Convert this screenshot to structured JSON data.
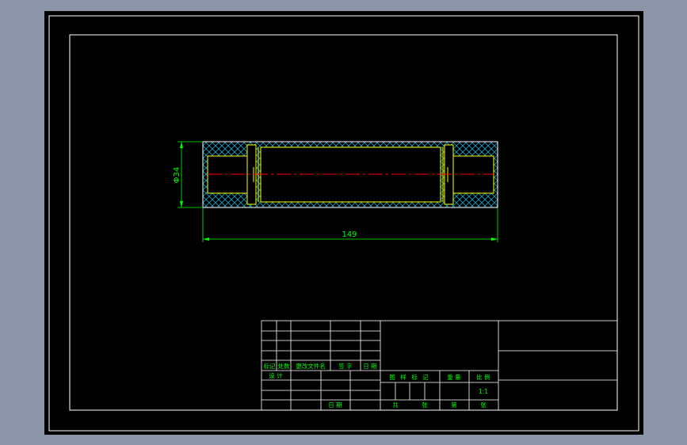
{
  "drawing": {
    "dimensions": {
      "diameter_label": "Φ34",
      "length_label": "149"
    },
    "title_block": {
      "revision_headers": [
        "标记",
        "处数",
        "更改文件名",
        "签 字",
        "日 期"
      ],
      "design_label": "设 计",
      "date_label": "日 期",
      "stage_mark_label": "图 样 标 记",
      "weight_label": "重 量",
      "scale_label": "比 例",
      "scale_value": "1:1",
      "total_label": "共",
      "sheet_unit_1": "张",
      "page_label": "第",
      "sheet_unit_2": "张"
    },
    "colors": {
      "background": "#000000",
      "frame": "#ffffff",
      "outline": "#ffff00",
      "hatch": "#00a0c8",
      "centerline": "#ff0000",
      "dimension": "#00ff00",
      "text": "#00ff00"
    }
  }
}
